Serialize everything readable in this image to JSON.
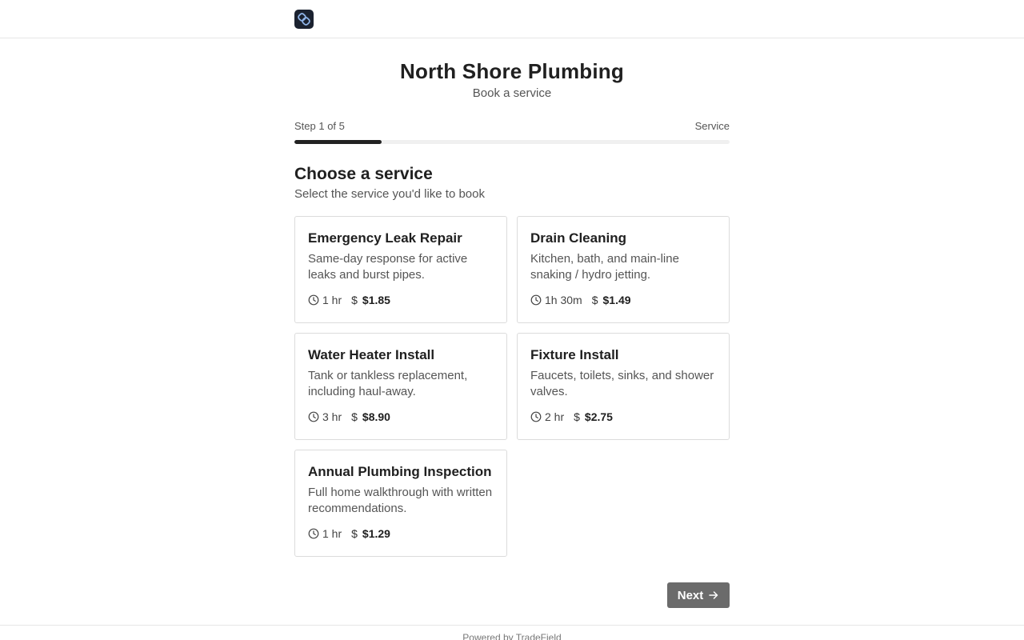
{
  "header": {
    "logo_icon": "chain-link-logo-icon"
  },
  "hero": {
    "title": "North Shore Plumbing",
    "subtitle": "Book a service"
  },
  "stepper": {
    "step_text": "Step 1 of 5",
    "step_name": "Service",
    "progress": 0.2
  },
  "section": {
    "title": "Choose a service",
    "subtitle": "Select the service you'd like to book"
  },
  "services": [
    {
      "title": "Emergency Leak Repair",
      "desc": "Same-day response for active leaks and burst pipes.",
      "duration": "1 hr",
      "price": "$1.85"
    },
    {
      "title": "Drain Cleaning",
      "desc": "Kitchen, bath, and main-line snaking / hydro jetting.",
      "duration": "1h 30m",
      "price": "$1.49"
    },
    {
      "title": "Water Heater Install",
      "desc": "Tank or tankless replacement, including haul-away.",
      "duration": "3 hr",
      "price": "$8.90"
    },
    {
      "title": "Fixture Install",
      "desc": "Faucets, toilets, sinks, and shower valves.",
      "duration": "2 hr",
      "price": "$2.75"
    },
    {
      "title": "Annual Plumbing Inspection",
      "desc": "Full home walkthrough with written recommendations.",
      "duration": "1 hr",
      "price": "$1.29"
    }
  ],
  "actions": {
    "next_label": "Next"
  },
  "footer": {
    "text": "Powered by TradeField"
  },
  "colors": {
    "accent": "#222222",
    "button_disabled": "#6b6b6b"
  }
}
